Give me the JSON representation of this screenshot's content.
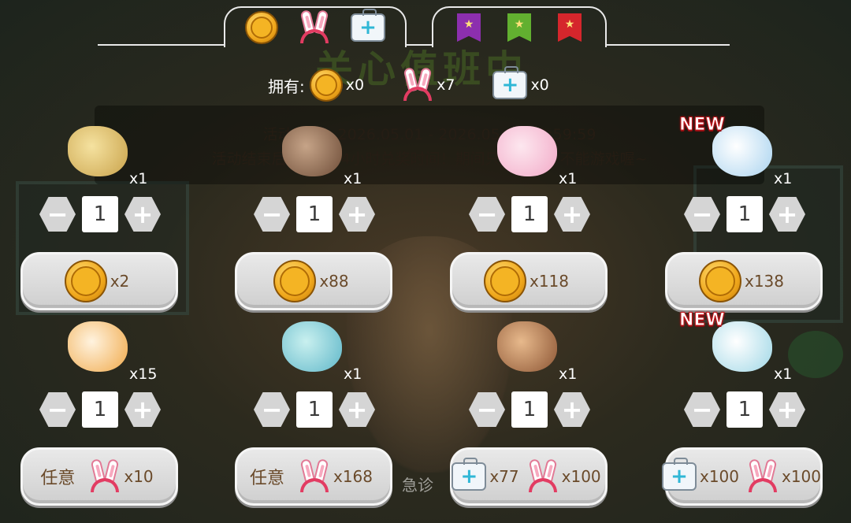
{
  "background": {
    "title_art": "关心值班中",
    "corner_text": "急诊"
  },
  "banner": {
    "line1": "活动时间：2026.05.01 - 2026.05.31 23:59:59",
    "line2": "活动结束后，还有24小时兑奖时间！期间只能兑奖，不能游戏喔~"
  },
  "tabs": [
    {
      "icons": [
        "coin-icon",
        "bunny-ears-icon",
        "medical-kit-icon"
      ],
      "active": true
    },
    {
      "icons": [
        "purple-pennant-icon",
        "green-pennant-icon",
        "red-pennant-icon"
      ],
      "active": false
    }
  ],
  "owned": {
    "label": "拥有:",
    "coins": "x0",
    "ears": "x7",
    "kits": "x0"
  },
  "rewards": [
    {
      "item": "treasure-scroll",
      "qty": "x1",
      "is_new": false,
      "amount": 1,
      "cost": [
        {
          "type": "coin",
          "amount": "x2"
        }
      ]
    },
    {
      "item": "bunny-gift-box",
      "qty": "x1",
      "is_new": false,
      "amount": 1,
      "cost": [
        {
          "type": "coin",
          "amount": "x88"
        }
      ]
    },
    {
      "item": "fairy-girl",
      "qty": "x1",
      "is_new": false,
      "amount": 1,
      "cost": [
        {
          "type": "coin",
          "amount": "x118"
        }
      ]
    },
    {
      "item": "nurse-bunny",
      "qty": "x1",
      "is_new": true,
      "amount": 1,
      "cost": [
        {
          "type": "coin",
          "amount": "x138"
        }
      ]
    },
    {
      "item": "puppy-puzzle",
      "qty": "x15",
      "is_new": false,
      "amount": 1,
      "cost": [
        {
          "type": "any",
          "label": "任意"
        },
        {
          "type": "ears",
          "amount": "x10"
        }
      ]
    },
    {
      "item": "mermaid-pet",
      "qty": "x1",
      "is_new": false,
      "amount": 1,
      "cost": [
        {
          "type": "any",
          "label": "任意"
        },
        {
          "type": "ears",
          "amount": "x168"
        }
      ]
    },
    {
      "item": "curly-hair-doll",
      "qty": "x1",
      "is_new": false,
      "amount": 1,
      "cost": [
        {
          "type": "kit",
          "amount": "x77"
        },
        {
          "type": "ears",
          "amount": "x100"
        }
      ]
    },
    {
      "item": "doctor-bunny",
      "qty": "x1",
      "is_new": true,
      "amount": 1,
      "cost": [
        {
          "type": "kit",
          "amount": "x100"
        },
        {
          "type": "ears",
          "amount": "x100"
        }
      ]
    }
  ],
  "labels": {
    "new": "NEW",
    "minus": "−",
    "plus": "+",
    "any": "任意"
  },
  "colors": {
    "button_face": "#dcdcdc",
    "cost_text": "#6a4a2a",
    "new_tag": "#c4161c"
  }
}
